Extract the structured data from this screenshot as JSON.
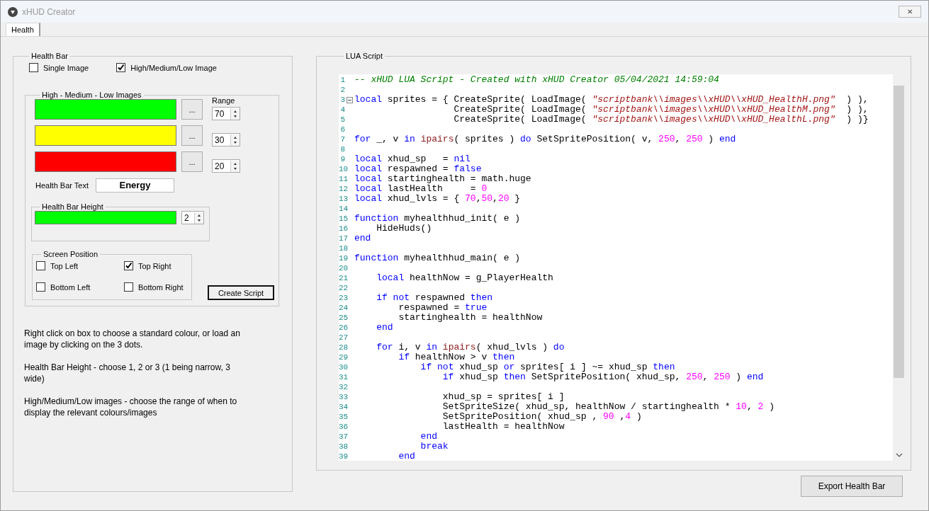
{
  "window": {
    "title": "xHUD Creator",
    "close": "✕"
  },
  "tabs": [
    {
      "label": "Health",
      "selected": true
    }
  ],
  "health_bar": {
    "title": "Health Bar",
    "modes": [
      {
        "label": "Single Image",
        "checked": false
      },
      {
        "label": "High/Medium/Low Image",
        "checked": true
      }
    ],
    "images": {
      "title": "High - Medium - Low Images",
      "range_label": "Range",
      "levels": [
        {
          "color": "#00ff00",
          "button": "...",
          "range": "70"
        },
        {
          "color": "#ffff00",
          "button": "...",
          "range": "30"
        },
        {
          "color": "#ff0000",
          "button": "...",
          "range": "20"
        }
      ],
      "text_label": "Health Bar Text",
      "text_value": "Energy",
      "height": {
        "title": "Health Bar Height",
        "color": "#00ff00",
        "value": "2"
      },
      "position": {
        "title": "Screen Position",
        "options": [
          {
            "label": "Top Left",
            "checked": false
          },
          {
            "label": "Top Right",
            "checked": true
          },
          {
            "label": "Bottom Left",
            "checked": false
          },
          {
            "label": "Bottom Right",
            "checked": false
          }
        ]
      },
      "create_button": "Create Script"
    },
    "help": [
      "Right click on box to choose a standard colour, or load an image by clicking on the 3 dots.",
      "Health Bar Height - choose 1, 2 or 3 (1 being narrow, 3 wide)",
      "High/Medium/Low images - choose the range of when to display the relevant colours/images"
    ]
  },
  "script": {
    "title": "LUA Script",
    "lines": [
      {
        "n": "1",
        "tokens": [
          {
            "kind": "comment",
            "text": "-- xHUD LUA Script - Created with xHUD Creator 05/04/2021 14:59:04"
          }
        ]
      },
      {
        "n": "2"
      },
      {
        "n": "3",
        "fold": true,
        "tokens": [
          {
            "kind": "keyword",
            "text": "local"
          },
          {
            "kind": "plain",
            "text": " sprites = { CreateSprite( LoadImage( "
          },
          {
            "kind": "string",
            "text": "\"scriptbank\\\\images\\\\xHUD\\\\xHUD_HealthH.png\""
          },
          {
            "kind": "plain",
            "text": "  ) ),"
          }
        ]
      },
      {
        "n": "4",
        "tokens": [
          {
            "kind": "plain",
            "text": "                  CreateSprite( LoadImage( "
          },
          {
            "kind": "string",
            "text": "\"scriptbank\\\\images\\\\xHUD\\\\xHUD_HealthM.png\""
          },
          {
            "kind": "plain",
            "text": "  ) ),"
          }
        ]
      },
      {
        "n": "5",
        "tokens": [
          {
            "kind": "plain",
            "text": "                  CreateSprite( LoadImage( "
          },
          {
            "kind": "string",
            "text": "\"scriptbank\\\\images\\\\xHUD\\\\xHUD_HealthL.png\""
          },
          {
            "kind": "plain",
            "text": "  ) )}"
          }
        ]
      },
      {
        "n": "6"
      },
      {
        "n": "7",
        "tokens": [
          {
            "kind": "keyword",
            "text": "for"
          },
          {
            "kind": "plain",
            "text": " _, v "
          },
          {
            "kind": "keyword",
            "text": "in "
          },
          {
            "kind": "builtin",
            "text": "ipairs"
          },
          {
            "kind": "plain",
            "text": "( sprites ) "
          },
          {
            "kind": "keyword",
            "text": "do"
          },
          {
            "kind": "plain",
            "text": " SetSpritePosition( v, "
          },
          {
            "kind": "number",
            "text": "250"
          },
          {
            "kind": "plain",
            "text": ", "
          },
          {
            "kind": "number",
            "text": "250"
          },
          {
            "kind": "plain",
            "text": " ) "
          },
          {
            "kind": "keyword",
            "text": "end"
          }
        ]
      },
      {
        "n": "8"
      },
      {
        "n": "9",
        "tokens": [
          {
            "kind": "keyword",
            "text": "local"
          },
          {
            "kind": "plain",
            "text": " xhud_sp   = "
          },
          {
            "kind": "keyword",
            "text": "nil"
          }
        ]
      },
      {
        "n": "10",
        "tokens": [
          {
            "kind": "keyword",
            "text": "local"
          },
          {
            "kind": "plain",
            "text": " respawned = "
          },
          {
            "kind": "keyword",
            "text": "false"
          }
        ]
      },
      {
        "n": "11",
        "tokens": [
          {
            "kind": "keyword",
            "text": "local"
          },
          {
            "kind": "plain",
            "text": " startinghealth = math.huge"
          }
        ]
      },
      {
        "n": "12",
        "tokens": [
          {
            "kind": "keyword",
            "text": "local"
          },
          {
            "kind": "plain",
            "text": " lastHealth     = "
          },
          {
            "kind": "number",
            "text": "0"
          }
        ]
      },
      {
        "n": "13",
        "tokens": [
          {
            "kind": "keyword",
            "text": "local"
          },
          {
            "kind": "plain",
            "text": " xhud_lvls = { "
          },
          {
            "kind": "number",
            "text": "70"
          },
          {
            "kind": "plain",
            "text": ","
          },
          {
            "kind": "number",
            "text": "50"
          },
          {
            "kind": "plain",
            "text": ","
          },
          {
            "kind": "number",
            "text": "20"
          },
          {
            "kind": "plain",
            "text": " }"
          }
        ]
      },
      {
        "n": "14"
      },
      {
        "n": "15",
        "tokens": [
          {
            "kind": "keyword",
            "text": "function"
          },
          {
            "kind": "plain",
            "text": " myhealthhud_init( e )"
          }
        ]
      },
      {
        "n": "16",
        "tokens": [
          {
            "kind": "plain",
            "text": "    HideHuds()"
          }
        ]
      },
      {
        "n": "17",
        "tokens": [
          {
            "kind": "keyword",
            "text": "end"
          }
        ]
      },
      {
        "n": "18"
      },
      {
        "n": "19",
        "tokens": [
          {
            "kind": "keyword",
            "text": "function"
          },
          {
            "kind": "plain",
            "text": " myhealthhud_main( e )"
          }
        ]
      },
      {
        "n": "20"
      },
      {
        "n": "21",
        "tokens": [
          {
            "kind": "keyword",
            "text": "    local"
          },
          {
            "kind": "plain",
            "text": " healthNow = g_PlayerHealth"
          }
        ]
      },
      {
        "n": "22"
      },
      {
        "n": "23",
        "tokens": [
          {
            "kind": "keyword",
            "text": "    if "
          },
          {
            "kind": "keyword",
            "text": "not"
          },
          {
            "kind": "plain",
            "text": " respawned "
          },
          {
            "kind": "keyword",
            "text": "then"
          }
        ]
      },
      {
        "n": "24",
        "tokens": [
          {
            "kind": "plain",
            "text": "        respawned = "
          },
          {
            "kind": "keyword",
            "text": "true"
          }
        ]
      },
      {
        "n": "25",
        "tokens": [
          {
            "kind": "plain",
            "text": "        startinghealth = healthNow"
          }
        ]
      },
      {
        "n": "26",
        "tokens": [
          {
            "kind": "keyword",
            "text": "    end"
          }
        ]
      },
      {
        "n": "27"
      },
      {
        "n": "28",
        "tokens": [
          {
            "kind": "keyword",
            "text": "    for"
          },
          {
            "kind": "plain",
            "text": " i, v "
          },
          {
            "kind": "keyword",
            "text": "in "
          },
          {
            "kind": "builtin",
            "text": "ipairs"
          },
          {
            "kind": "plain",
            "text": "( xhud_lvls ) "
          },
          {
            "kind": "keyword",
            "text": "do"
          }
        ]
      },
      {
        "n": "29",
        "tokens": [
          {
            "kind": "keyword",
            "text": "        if"
          },
          {
            "kind": "plain",
            "text": " healthNow > v "
          },
          {
            "kind": "keyword",
            "text": "then"
          }
        ]
      },
      {
        "n": "30",
        "tokens": [
          {
            "kind": "keyword",
            "text": "            if "
          },
          {
            "kind": "keyword",
            "text": "not"
          },
          {
            "kind": "plain",
            "text": " xhud_sp "
          },
          {
            "kind": "keyword",
            "text": "or"
          },
          {
            "kind": "plain",
            "text": " sprites[ i ] ~= xhud_sp "
          },
          {
            "kind": "keyword",
            "text": "then"
          }
        ]
      },
      {
        "n": "31",
        "tokens": [
          {
            "kind": "keyword",
            "text": "                if"
          },
          {
            "kind": "plain",
            "text": " xhud_sp "
          },
          {
            "kind": "keyword",
            "text": "then"
          },
          {
            "kind": "plain",
            "text": " SetSpritePosition( xhud_sp, "
          },
          {
            "kind": "number",
            "text": "250"
          },
          {
            "kind": "plain",
            "text": ", "
          },
          {
            "kind": "number",
            "text": "250"
          },
          {
            "kind": "plain",
            "text": " ) "
          },
          {
            "kind": "keyword",
            "text": "end"
          }
        ]
      },
      {
        "n": "32"
      },
      {
        "n": "33",
        "tokens": [
          {
            "kind": "plain",
            "text": "                xhud_sp = sprites[ i ]"
          }
        ]
      },
      {
        "n": "34",
        "tokens": [
          {
            "kind": "plain",
            "text": "                SetSpriteSize( xhud_sp, healthNow / startinghealth * "
          },
          {
            "kind": "number",
            "text": "10"
          },
          {
            "kind": "plain",
            "text": ", "
          },
          {
            "kind": "number",
            "text": "2"
          },
          {
            "kind": "plain",
            "text": " )"
          }
        ]
      },
      {
        "n": "35",
        "tokens": [
          {
            "kind": "plain",
            "text": "                SetSpritePosition( xhud_sp , "
          },
          {
            "kind": "number",
            "text": "90"
          },
          {
            "kind": "plain",
            "text": " ,"
          },
          {
            "kind": "number",
            "text": "4"
          },
          {
            "kind": "plain",
            "text": " )"
          }
        ]
      },
      {
        "n": "36",
        "tokens": [
          {
            "kind": "plain",
            "text": "                lastHealth = healthNow"
          }
        ]
      },
      {
        "n": "37",
        "tokens": [
          {
            "kind": "keyword",
            "text": "            end"
          }
        ]
      },
      {
        "n": "38",
        "tokens": [
          {
            "kind": "keyword",
            "text": "            break"
          }
        ]
      },
      {
        "n": "39",
        "tokens": [
          {
            "kind": "keyword",
            "text": "        end"
          }
        ]
      }
    ]
  },
  "export_button": "Export Health Bar"
}
